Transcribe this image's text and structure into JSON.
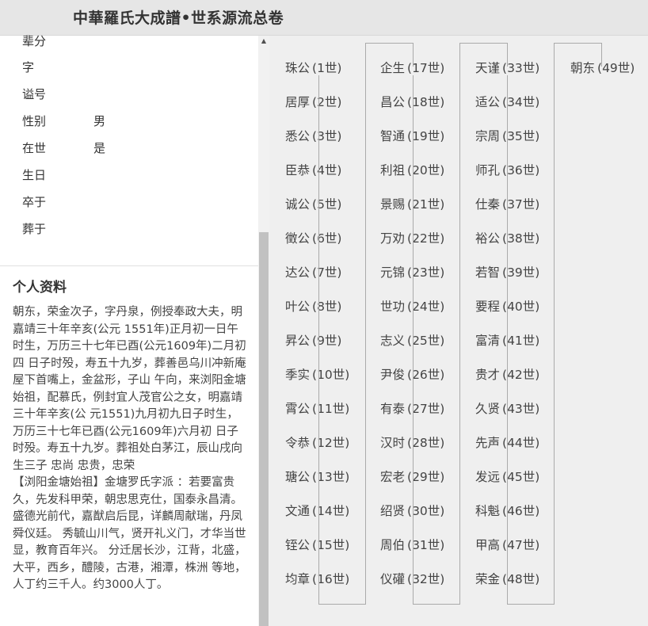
{
  "header": {
    "title": "中華羅氏大成譜•世系源流总卷"
  },
  "profile": {
    "fields": [
      {
        "label": "辈分",
        "value": ""
      },
      {
        "label": "字",
        "value": ""
      },
      {
        "label": "谥号",
        "value": ""
      },
      {
        "label": "性别",
        "value": "男"
      },
      {
        "label": "在世",
        "value": "是"
      },
      {
        "label": "生日",
        "value": ""
      },
      {
        "label": "卒于",
        "value": ""
      },
      {
        "label": "葬于",
        "value": ""
      }
    ],
    "section_title": "个人资料",
    "bio": "朝东，荣金次子，字丹泉，例授奉政大夫，明嘉靖三十年辛亥(公元 1551年)正月初一日午时生，万历三十七年已酉(公元1609年)二月初四 日子时殁，寿五十九岁，葬善邑乌川冲新庵屋下首嘴上，金盆形，子山 午向，来浏阳金塘始祖，配慕氏，例封宜人茂官公之女，明嘉靖三十年辛亥(公 元1551)九月初九日子时生，万历三十七年已酉(公元1609年)六月初 日子时殁。寿五十九岁。葬祖处白茅江，辰山戌向 生三子 忠尚 忠贵，忠荣\n【浏阳金塘始祖】金塘罗氏字派 ：若要富贵久，先发科甲荣，朝忠思克仕，国泰永昌清。 盛德光前代，嘉猷启后昆，详麟周献瑞，丹凤舜仪廷。 秀毓山川气，贤开礼义门，才华当世显，教育百年兴。 分迁居长沙，江背，北盛，大平，西乡，醴陵，古港，湘潭，株洲 等地，人丁约三千人。约3000人丁。"
  },
  "generations": [
    {
      "name": "珠公",
      "gen": "(1世)"
    },
    {
      "name": "居厚",
      "gen": "(2世)"
    },
    {
      "name": "悉公",
      "gen": "(3世)"
    },
    {
      "name": "臣恭",
      "gen": "(4世)"
    },
    {
      "name": "诚公",
      "gen": "(5世)"
    },
    {
      "name": "徵公",
      "gen": "(6世)"
    },
    {
      "name": "达公",
      "gen": "(7世)"
    },
    {
      "name": "叶公",
      "gen": "(8世)"
    },
    {
      "name": "昇公",
      "gen": "(9世)"
    },
    {
      "name": "季实",
      "gen": "(10世)"
    },
    {
      "name": "霄公",
      "gen": "(11世)"
    },
    {
      "name": "令恭",
      "gen": "(12世)"
    },
    {
      "name": "瑭公",
      "gen": "(13世)"
    },
    {
      "name": "文通",
      "gen": "(14世)"
    },
    {
      "name": "铚公",
      "gen": "(15世)"
    },
    {
      "name": "均章",
      "gen": "(16世)"
    },
    {
      "name": "企生",
      "gen": "(17世)"
    },
    {
      "name": "昌公",
      "gen": "(18世)"
    },
    {
      "name": "智通",
      "gen": "(19世)"
    },
    {
      "name": "利祖",
      "gen": "(20世)"
    },
    {
      "name": "景赐",
      "gen": "(21世)"
    },
    {
      "name": "万劝",
      "gen": "(22世)"
    },
    {
      "name": "元锦",
      "gen": "(23世)"
    },
    {
      "name": "世功",
      "gen": "(24世)"
    },
    {
      "name": "志义",
      "gen": "(25世)"
    },
    {
      "name": "尹俊",
      "gen": "(26世)"
    },
    {
      "name": "有泰",
      "gen": "(27世)"
    },
    {
      "name": "汉时",
      "gen": "(28世)"
    },
    {
      "name": "宏老",
      "gen": "(29世)"
    },
    {
      "name": "绍贤",
      "gen": "(30世)"
    },
    {
      "name": "周伯",
      "gen": "(31世)"
    },
    {
      "name": "仪礶",
      "gen": "(32世)"
    },
    {
      "name": "天谨",
      "gen": "(33世)"
    },
    {
      "name": "适公",
      "gen": "(34世)"
    },
    {
      "name": "宗周",
      "gen": "(35世)"
    },
    {
      "name": "师孔",
      "gen": "(36世)"
    },
    {
      "name": "仕秦",
      "gen": "(37世)"
    },
    {
      "name": "裕公",
      "gen": "(38世)"
    },
    {
      "name": "若智",
      "gen": "(39世)"
    },
    {
      "name": "要程",
      "gen": "(40世)"
    },
    {
      "name": "富清",
      "gen": "(41世)"
    },
    {
      "name": "贵才",
      "gen": "(42世)"
    },
    {
      "name": "久贤",
      "gen": "(43世)"
    },
    {
      "name": "先声",
      "gen": "(44世)"
    },
    {
      "name": "发远",
      "gen": "(45世)"
    },
    {
      "name": "科魁",
      "gen": "(46世)"
    },
    {
      "name": "甲高",
      "gen": "(47世)"
    },
    {
      "name": "荣金",
      "gen": "(48世)"
    },
    {
      "name": "朝东",
      "gen": "(49世)"
    }
  ]
}
